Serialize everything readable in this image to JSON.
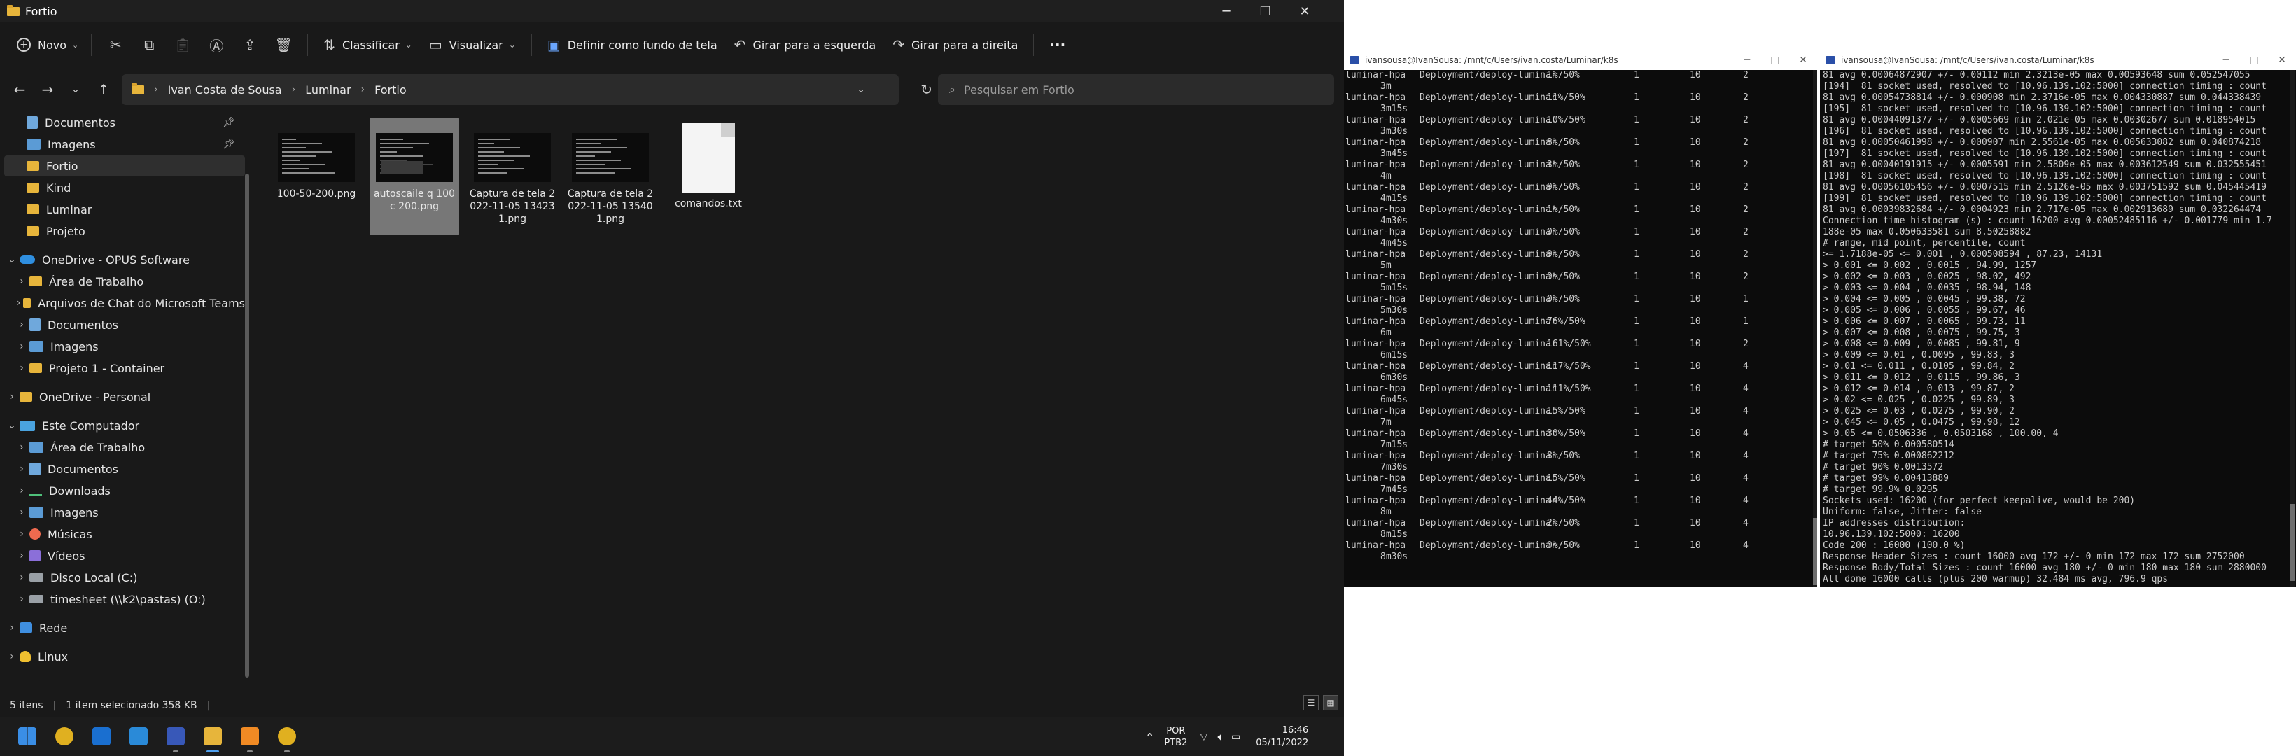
{
  "explorer": {
    "title": "Fortio",
    "toolbar": {
      "new_label": "Novo",
      "sort_label": "Classificar",
      "view_label": "Visualizar",
      "wallpaper_label": "Definir como fundo de tela",
      "rotate_left_label": "Girar para a esquerda",
      "rotate_right_label": "Girar para a direita",
      "more_label": "···"
    },
    "address": {
      "segments": [
        "Ivan Costa de Sousa",
        "Luminar",
        "Fortio"
      ],
      "search_placeholder": "Pesquisar em Fortio"
    },
    "nav": {
      "items": [
        {
          "label": "Documentos",
          "icon": "documents-icon",
          "pinned": true
        },
        {
          "label": "Imagens",
          "icon": "pictures-icon",
          "pinned": true
        },
        {
          "label": "Fortio",
          "icon": "folder-icon",
          "selected": true
        },
        {
          "label": "Kind",
          "icon": "folder-icon"
        },
        {
          "label": "Luminar",
          "icon": "folder-icon"
        },
        {
          "label": "Projeto",
          "icon": "folder-icon"
        },
        {
          "label": "OneDrive - OPUS Software",
          "icon": "onedrive-icon",
          "expanded": true
        },
        {
          "label": "Área de Trabalho",
          "icon": "folder-icon"
        },
        {
          "label": "Arquivos de Chat do Microsoft Teams",
          "icon": "folder-icon"
        },
        {
          "label": "Documentos",
          "icon": "documents-icon"
        },
        {
          "label": "Imagens",
          "icon": "pictures-icon"
        },
        {
          "label": "Projeto 1 - Container",
          "icon": "folder-icon"
        },
        {
          "label": "OneDrive - Personal",
          "icon": "folder-icon"
        },
        {
          "label": "Este Computador",
          "icon": "computer-icon",
          "expanded": true
        },
        {
          "label": "Área de Trabalho",
          "icon": "desktop-icon"
        },
        {
          "label": "Documentos",
          "icon": "documents-icon"
        },
        {
          "label": "Downloads",
          "icon": "download-icon"
        },
        {
          "label": "Imagens",
          "icon": "pictures-icon"
        },
        {
          "label": "Músicas",
          "icon": "music-icon"
        },
        {
          "label": "Vídeos",
          "icon": "video-icon"
        },
        {
          "label": "Disco Local (C:)",
          "icon": "drive-icon"
        },
        {
          "label": "timesheet (\\\\k2\\pastas) (O:)",
          "icon": "network-drive-icon"
        },
        {
          "label": "Rede",
          "icon": "network-icon"
        },
        {
          "label": "Linux",
          "icon": "linux-icon"
        }
      ]
    },
    "files": [
      {
        "name": "100-50-200.png",
        "type": "image"
      },
      {
        "name": "autoscaile q 100 c 200.png",
        "type": "image",
        "selected": true
      },
      {
        "name": "Captura de tela 2022-11-05 134231.png",
        "type": "image"
      },
      {
        "name": "Captura de tela 2022-11-05 135401.png",
        "type": "image"
      },
      {
        "name": "comandos.txt",
        "type": "text"
      }
    ],
    "status": {
      "items_count": "5 itens",
      "selection": "1 item selecionado  358 KB"
    }
  },
  "terminal_left": {
    "title": "ivansousa@IvanSousa: /mnt/c/Users/ivan.costa/Luminar/k8s",
    "rows": [
      {
        "name": "luminar-hpa",
        "ref": "Deployment/deploy-luminar",
        "targets": "1%/50%",
        "min": "1",
        "max": "10",
        "replicas": "2",
        "age": "3m"
      },
      {
        "name": "luminar-hpa",
        "ref": "Deployment/deploy-luminar",
        "targets": "11%/50%",
        "min": "1",
        "max": "10",
        "replicas": "2",
        "age": "3m15s"
      },
      {
        "name": "luminar-hpa",
        "ref": "Deployment/deploy-luminar",
        "targets": "10%/50%",
        "min": "1",
        "max": "10",
        "replicas": "2",
        "age": "3m30s"
      },
      {
        "name": "luminar-hpa",
        "ref": "Deployment/deploy-luminar",
        "targets": "8%/50%",
        "min": "1",
        "max": "10",
        "replicas": "2",
        "age": "3m45s"
      },
      {
        "name": "luminar-hpa",
        "ref": "Deployment/deploy-luminar",
        "targets": "3%/50%",
        "min": "1",
        "max": "10",
        "replicas": "2",
        "age": "4m"
      },
      {
        "name": "luminar-hpa",
        "ref": "Deployment/deploy-luminar",
        "targets": "9%/50%",
        "min": "1",
        "max": "10",
        "replicas": "2",
        "age": "4m15s"
      },
      {
        "name": "luminar-hpa",
        "ref": "Deployment/deploy-luminar",
        "targets": "1%/50%",
        "min": "1",
        "max": "10",
        "replicas": "2",
        "age": "4m30s"
      },
      {
        "name": "luminar-hpa",
        "ref": "Deployment/deploy-luminar",
        "targets": "0%/50%",
        "min": "1",
        "max": "10",
        "replicas": "2",
        "age": "4m45s"
      },
      {
        "name": "luminar-hpa",
        "ref": "Deployment/deploy-luminar",
        "targets": "9%/50%",
        "min": "1",
        "max": "10",
        "replicas": "2",
        "age": "5m"
      },
      {
        "name": "luminar-hpa",
        "ref": "Deployment/deploy-luminar",
        "targets": "9%/50%",
        "min": "1",
        "max": "10",
        "replicas": "2",
        "age": "5m15s"
      },
      {
        "name": "luminar-hpa",
        "ref": "Deployment/deploy-luminar",
        "targets": "0%/50%",
        "min": "1",
        "max": "10",
        "replicas": "1",
        "age": "5m30s"
      },
      {
        "name": "luminar-hpa",
        "ref": "Deployment/deploy-luminar",
        "targets": "76%/50%",
        "min": "1",
        "max": "10",
        "replicas": "1",
        "age": "6m"
      },
      {
        "name": "luminar-hpa",
        "ref": "Deployment/deploy-luminar",
        "targets": "161%/50%",
        "min": "1",
        "max": "10",
        "replicas": "2",
        "age": "6m15s"
      },
      {
        "name": "luminar-hpa",
        "ref": "Deployment/deploy-luminar",
        "targets": "117%/50%",
        "min": "1",
        "max": "10",
        "replicas": "4",
        "age": "6m30s"
      },
      {
        "name": "luminar-hpa",
        "ref": "Deployment/deploy-luminar",
        "targets": "111%/50%",
        "min": "1",
        "max": "10",
        "replicas": "4",
        "age": "6m45s"
      },
      {
        "name": "luminar-hpa",
        "ref": "Deployment/deploy-luminar",
        "targets": "15%/50%",
        "min": "1",
        "max": "10",
        "replicas": "4",
        "age": "7m"
      },
      {
        "name": "luminar-hpa",
        "ref": "Deployment/deploy-luminar",
        "targets": "30%/50%",
        "min": "1",
        "max": "10",
        "replicas": "4",
        "age": "7m15s"
      },
      {
        "name": "luminar-hpa",
        "ref": "Deployment/deploy-luminar",
        "targets": "8%/50%",
        "min": "1",
        "max": "10",
        "replicas": "4",
        "age": "7m30s"
      },
      {
        "name": "luminar-hpa",
        "ref": "Deployment/deploy-luminar",
        "targets": "15%/50%",
        "min": "1",
        "max": "10",
        "replicas": "4",
        "age": "7m45s"
      },
      {
        "name": "luminar-hpa",
        "ref": "Deployment/deploy-luminar",
        "targets": "44%/50%",
        "min": "1",
        "max": "10",
        "replicas": "4",
        "age": "8m"
      },
      {
        "name": "luminar-hpa",
        "ref": "Deployment/deploy-luminar",
        "targets": "2%/50%",
        "min": "1",
        "max": "10",
        "replicas": "4",
        "age": "8m15s"
      },
      {
        "name": "luminar-hpa",
        "ref": "Deployment/deploy-luminar",
        "targets": "0%/50%",
        "min": "1",
        "max": "10",
        "replicas": "4",
        "age": "8m30s"
      }
    ]
  },
  "terminal_right": {
    "title": "ivansousa@IvanSousa: /mnt/c/Users/ivan.costa/Luminar/k8s",
    "lines": [
      "81 avg 0.00064872907 +/- 0.00112 min 2.3213e-05 max 0.00593648 sum 0.052547055",
      "[194]  81 socket used, resolved to [10.96.139.102:5000] connection timing : count",
      "81 avg 0.00054738814 +/- 0.000908 min 2.3716e-05 max 0.004330887 sum 0.044338439",
      "[195]  81 socket used, resolved to [10.96.139.102:5000] connection timing : count",
      "81 avg 0.00044091377 +/- 0.0005669 min 2.021e-05 max 0.00302677 sum 0.018954015",
      "[196]  81 socket used, resolved to [10.96.139.102:5000] connection timing : count",
      "81 avg 0.00050461998 +/- 0.000907 min 2.5561e-05 max 0.005633082 sum 0.040874218",
      "[197]  81 socket used, resolved to [10.96.139.102:5000] connection timing : count",
      "81 avg 0.00040191915 +/- 0.0005591 min 2.5809e-05 max 0.003612549 sum 0.032555451",
      "[198]  81 socket used, resolved to [10.96.139.102:5000] connection timing : count",
      "81 avg 0.00056105456 +/- 0.0007515 min 2.5126e-05 max 0.003751592 sum 0.045445419",
      "[199]  81 socket used, resolved to [10.96.139.102:5000] connection timing : count",
      "81 avg 0.00039832684 +/- 0.0004923 min 2.717e-05 max 0.002913689 sum 0.032264474",
      "Connection time histogram (s) : count 16200 avg 0.00052485116 +/- 0.001779 min 1.7",
      "188e-05 max 0.050633581 sum 8.50258882",
      "# range, mid point, percentile, count",
      ">= 1.7188e-05 <= 0.001 , 0.000508594 , 87.23, 14131",
      "> 0.001 <= 0.002 , 0.0015 , 94.99, 1257",
      "> 0.002 <= 0.003 , 0.0025 , 98.02, 492",
      "> 0.003 <= 0.004 , 0.0035 , 98.94, 148",
      "> 0.004 <= 0.005 , 0.0045 , 99.38, 72",
      "> 0.005 <= 0.006 , 0.0055 , 99.67, 46",
      "> 0.006 <= 0.007 , 0.0065 , 99.73, 11",
      "> 0.007 <= 0.008 , 0.0075 , 99.75, 3",
      "> 0.008 <= 0.009 , 0.0085 , 99.81, 9",
      "> 0.009 <= 0.01 , 0.0095 , 99.83, 3",
      "> 0.01 <= 0.011 , 0.0105 , 99.84, 2",
      "> 0.011 <= 0.012 , 0.0115 , 99.86, 3",
      "> 0.012 <= 0.014 , 0.013 , 99.87, 2",
      "> 0.02 <= 0.025 , 0.0225 , 99.89, 3",
      "> 0.025 <= 0.03 , 0.0275 , 99.90, 2",
      "> 0.045 <= 0.05 , 0.0475 , 99.98, 12",
      "> 0.05 <= 0.0506336 , 0.0503168 , 100.00, 4",
      "# target 50% 0.000580514",
      "# target 75% 0.000862212",
      "# target 90% 0.0013572",
      "# target 99% 0.00413889",
      "# target 99.9% 0.0295",
      "Sockets used: 16200 (for perfect keepalive, would be 200)",
      "Uniform: false, Jitter: false",
      "IP addresses distribution:",
      "10.96.139.102:5000: 16200",
      "Code 200 : 16000 (100.0 %)",
      "Response Header Sizes : count 16000 avg 172 +/- 0 min 172 max 172 sum 2752000",
      "Response Body/Total Sizes : count 16000 avg 180 +/- 0 min 180 max 180 sum 2880000",
      "All done 16000 calls (plus 200 warmup) 32.484 ms avg, 796.9 qps"
    ]
  },
  "taskbar": {
    "apps": [
      "start-icon",
      "chrome-icon",
      "outlook-icon",
      "vscode-icon",
      "powershell-icon",
      "file-explorer-icon",
      "sublime-icon",
      "chrome-icon"
    ],
    "language": "POR",
    "layout": "PTB2",
    "time": "16:46",
    "date": "05/11/2022"
  }
}
